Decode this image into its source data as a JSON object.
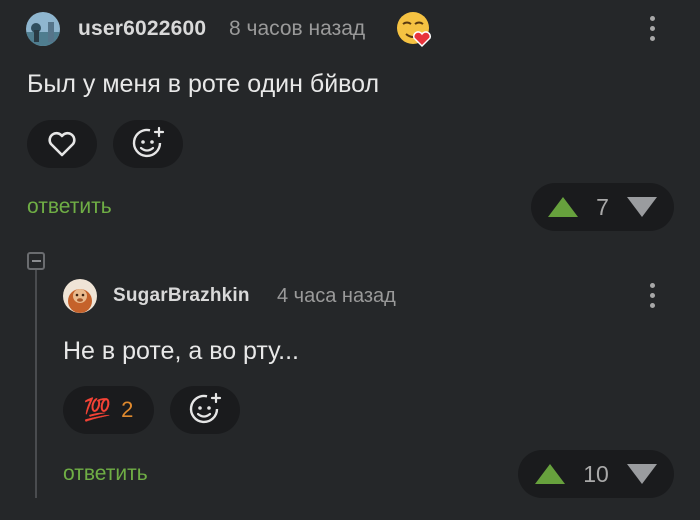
{
  "comments": [
    {
      "username": "user6022600",
      "time": "8 часов назад",
      "text": "Был у меня в роте один бйвол",
      "reply_label": "ответить",
      "rating": "7"
    },
    {
      "username": "SugarBrazhkin",
      "time": "4 часа назад",
      "text": "Не в роте, а во рту...",
      "reaction_emoji": "💯",
      "reaction_count": "2",
      "reply_label": "ответить",
      "rating": "10"
    }
  ],
  "colors": {
    "background": "#252729",
    "pill": "#1a1b1d",
    "accent_green": "#6fae45",
    "reaction_count": "#e08a2e"
  },
  "icons": [
    "avatar",
    "emoji-heart-face-icon",
    "more-icon",
    "heart-icon",
    "add-reaction-icon",
    "upvote-icon",
    "downvote-icon",
    "collapse-icon",
    "hundred-points-emoji"
  ]
}
